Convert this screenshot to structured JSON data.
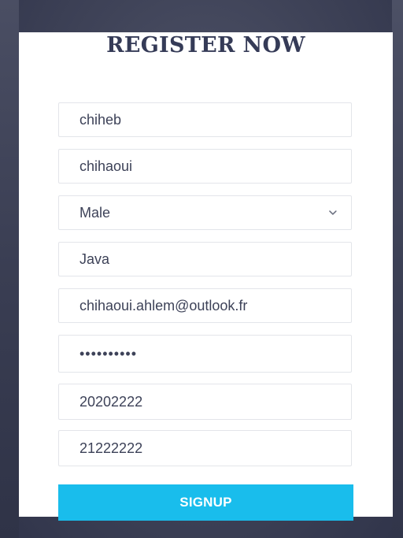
{
  "form": {
    "title": "REGISTER NOW",
    "first_name": "chiheb",
    "last_name": "chihaoui",
    "gender": {
      "selected": "Male"
    },
    "language": "Java",
    "email": "chihaoui.ahlem@outlook.fr",
    "password_mask": "••••••••••",
    "phone_1": "20202222",
    "phone_2": "21222222",
    "submit_label": "SIGNUP"
  },
  "colors": {
    "button": "#19bdec",
    "title": "#353b57",
    "background": "#3f4358"
  },
  "icons": {
    "select_arrow": "chevron-down-icon"
  }
}
